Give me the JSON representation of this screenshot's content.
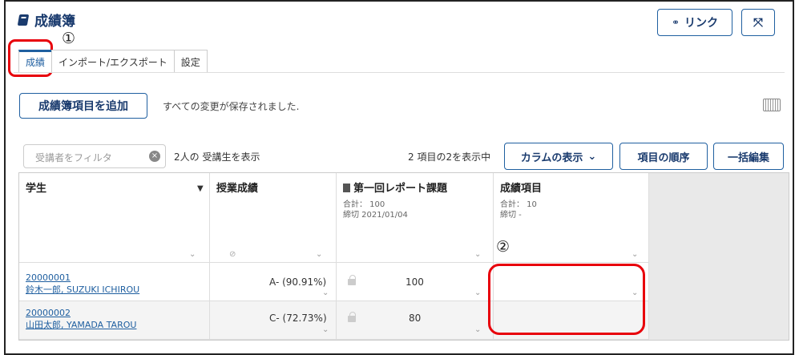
{
  "header": {
    "title": "成績簿",
    "link_label": "リンク",
    "link_icon": "link-icon",
    "expand_icon": "expand-icon"
  },
  "annotations": {
    "circle1": "①",
    "circle2": "②"
  },
  "tabs": [
    {
      "label": "成績",
      "active": true
    },
    {
      "label": "インポート/エクスポート",
      "active": false
    },
    {
      "label": "設定",
      "active": false
    }
  ],
  "toolbar": {
    "add_item_label": "成績簿項目を追加",
    "saved_status": "すべての変更が保存されました.",
    "filter_placeholder": "受講者をフィルタ",
    "students_shown": "2人の 受講生を表示",
    "items_shown": "2 項目の2を表示中",
    "columns_button": "カラムの表示",
    "order_button": "項目の順序",
    "bulk_edit_button": "一括編集"
  },
  "grid": {
    "columns": {
      "student": "学生",
      "course_grade": "授業成績",
      "report": {
        "title": "第一回レポート課題",
        "total": "合計： 100",
        "due": "締切 2021/01/04"
      },
      "grade_item": {
        "title": "成績項目",
        "total": "合計： 10",
        "due": "締切 -"
      }
    },
    "rows": [
      {
        "id": "20000001",
        "name": "鈴木一郎, SUZUKI ICHIROU",
        "course_grade": "A- (90.91%)",
        "report_score": "100",
        "item_score": ""
      },
      {
        "id": "20000002",
        "name": "山田太郎, YAMADA TAROU",
        "course_grade": "C- (72.73%)",
        "report_score": "80",
        "item_score": ""
      }
    ]
  },
  "colors": {
    "accent": "#1f5fa0",
    "title": "#1a3b6e",
    "highlight": "#e8000b"
  }
}
